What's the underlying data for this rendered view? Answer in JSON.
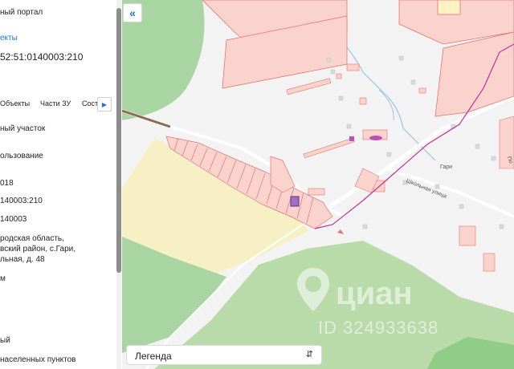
{
  "panel": {
    "portal_title": "ный портал",
    "objects_link": "екты",
    "cadastral_number": "52:51:0140003:210",
    "tabs": {
      "objects": "Объекты",
      "parts": "Части ЗУ",
      "composition": "Сост"
    },
    "fields": {
      "type": "ный участок",
      "usage": "ользование",
      "year": "018",
      "number": "140003:210",
      "quarter": "140003",
      "address_line1": "родская область,",
      "address_line2": "вский район, с.Гари,",
      "address_line3": "льная, д. 48",
      "unit": "м",
      "status": "ый",
      "category": "населенных пунктов"
    }
  },
  "map": {
    "village_label": "Гари",
    "street_label": "Школьная улица",
    "side_label": "По",
    "colors": {
      "parcel_fill": "#fbd3cd",
      "parcel_stroke": "#e57373",
      "forest": "#a8d5a2",
      "field": "#f7f0c4",
      "water": "#9cc3e6",
      "road": "#ffffff",
      "boundary": "#c030a0"
    }
  },
  "legend": {
    "label": "Легенда"
  },
  "watermark": {
    "brand": "циан",
    "id": "ID 324933638"
  },
  "icons": {
    "collapse": "chevrons-left-icon",
    "tab_next": "chevron-right-icon",
    "legend_toggle": "chevron-up-down-icon",
    "pin": "location-pin-icon"
  }
}
